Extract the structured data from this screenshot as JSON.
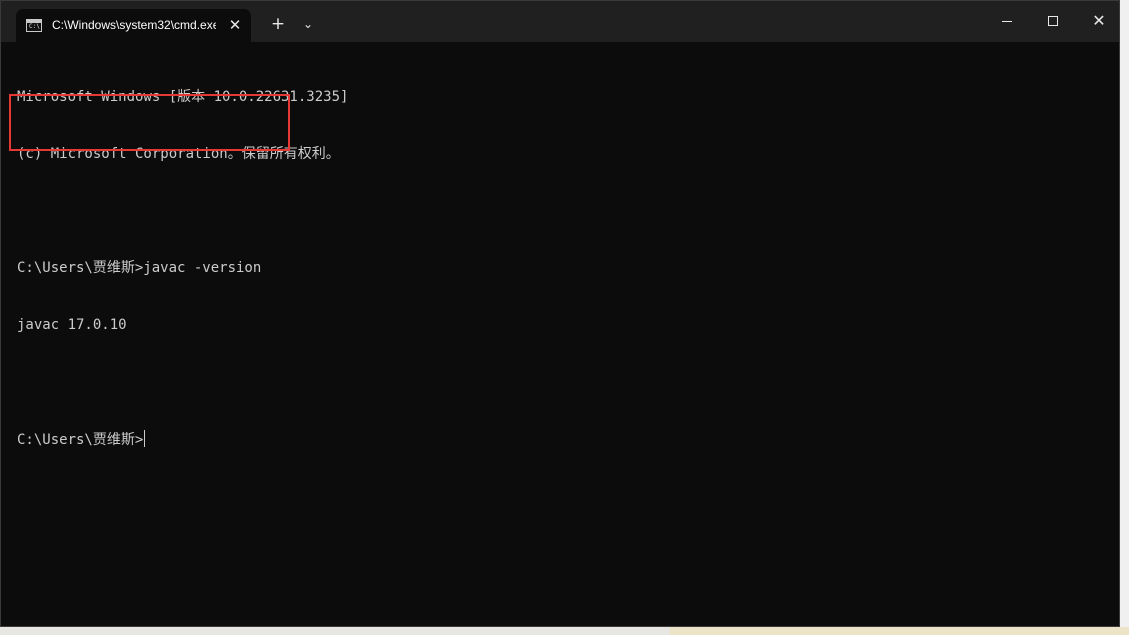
{
  "window": {
    "tab_title": "C:\\Windows\\system32\\cmd.exe",
    "tab_icon": "cmd-icon",
    "tab_icon_glyph": "C:\\",
    "tab_close": "✕",
    "new_tab": "+",
    "dropdown": "⌄",
    "controls": {
      "minimize": "minimize-icon",
      "maximize": "maximize-icon",
      "close": "✕"
    }
  },
  "terminal": {
    "lines": [
      "Microsoft Windows [版本 10.0.22631.3235]",
      "(c) Microsoft Corporation。保留所有权利。",
      "",
      "C:\\Users\\贾维斯>javac -version",
      "javac 17.0.10",
      "",
      "C:\\Users\\贾维斯>"
    ]
  },
  "colors": {
    "terminal_bg": "#0c0c0c",
    "terminal_text": "#cccccc",
    "titlebar_bg": "#202020",
    "highlight": "#e53935"
  }
}
